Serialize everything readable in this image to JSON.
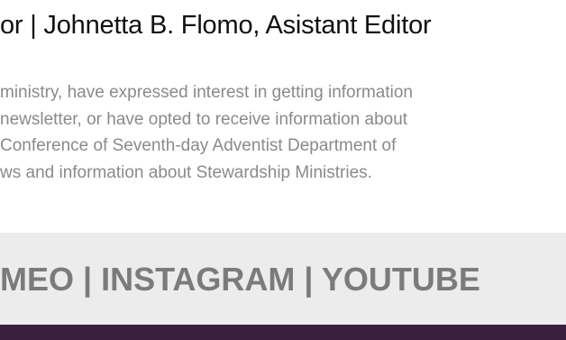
{
  "header": {
    "editor_credits": "or | Johnetta B. Flomo, Asistant Editor"
  },
  "disclaimer": {
    "lines": [
      "ministry, have expressed interest in getting information",
      "newsletter, or have opted to receive information about",
      "Conference of Seventh-day Adventist Department of",
      "ws and information about Stewardship Ministries."
    ]
  },
  "social": {
    "links_text": "MEO | INSTAGRAM | YOUTUBE"
  },
  "colors": {
    "heading_text": "#111111",
    "body_text": "#8a8a8a",
    "social_bar_bg": "#ececec",
    "social_text": "#7b7b7b",
    "footer_band": "#3b1f40"
  }
}
